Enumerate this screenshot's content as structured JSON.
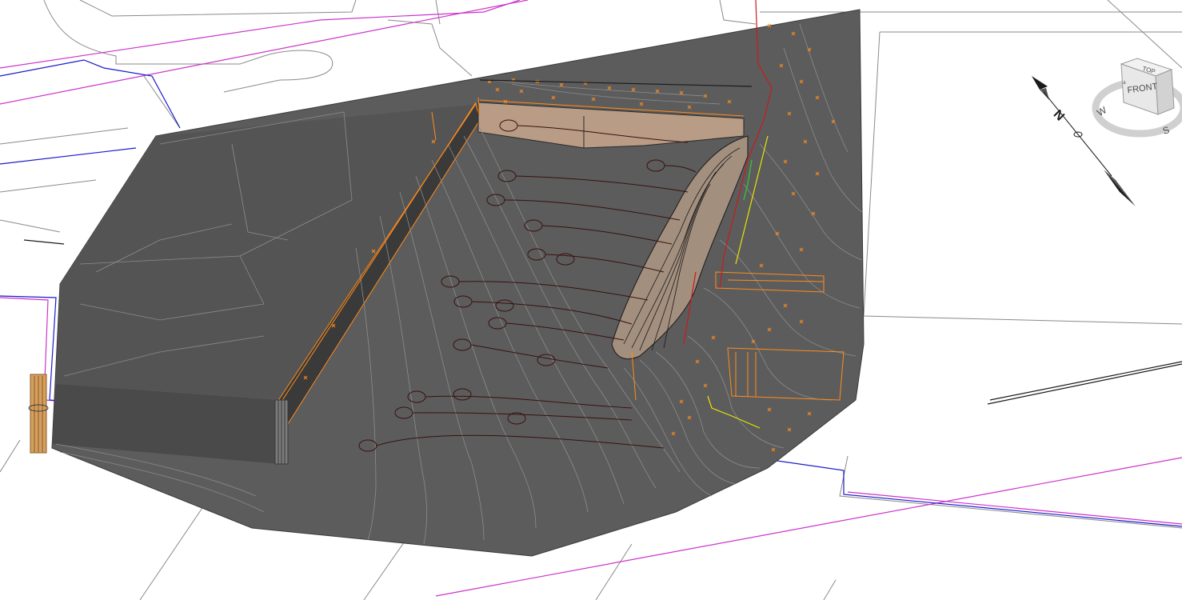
{
  "viewport": {
    "viewcube": {
      "top_label": "TOP",
      "front_label": "FRONT",
      "west_label": "W",
      "south_label": "S"
    },
    "north_arrow": {
      "label": "N"
    }
  },
  "colors": {
    "background": "#ffffff",
    "surface": "#5a5a5a",
    "surface_dark": "#3f3f3f",
    "contour": "#8c8c8c",
    "survey_points": "#ff8c1a",
    "property_line_magenta": "#cc33cc",
    "utility_blue": "#1a1acc",
    "utility_red": "#cc1a1a",
    "wall_face": "#b89c86",
    "pipe_path": "#3a1010",
    "linework": "#7a7a7a"
  }
}
